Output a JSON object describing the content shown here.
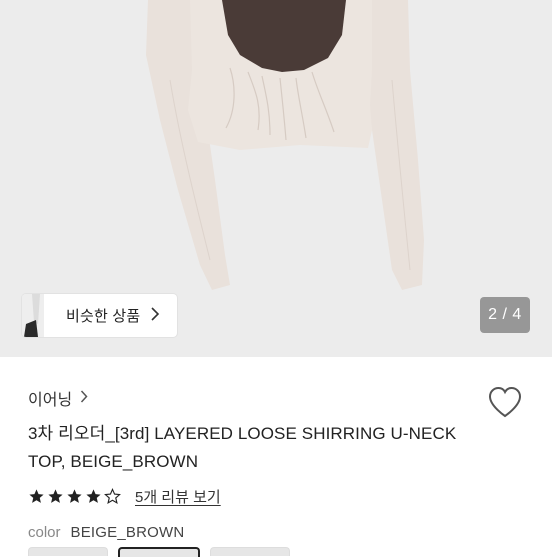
{
  "gallery": {
    "similar_button_label": "비슷한 상품",
    "page_indicator": "2 / 4"
  },
  "product": {
    "brand": "이어닝",
    "title": "3차 리오더_[3rd] LAYERED LOOSE SHIRRING U-NECK TOP, BEIGE_BROWN",
    "rating": 4,
    "rating_max": 5,
    "review_link_label": "5개 리뷰 보기",
    "color_label": "color",
    "color_value": "BEIGE_BROWN"
  },
  "colors": {
    "gallery_bg": "#ececec",
    "garment_beige": "#e9e1db",
    "inner_brown": "#4a3b37",
    "indicator_bg": "#979797"
  }
}
